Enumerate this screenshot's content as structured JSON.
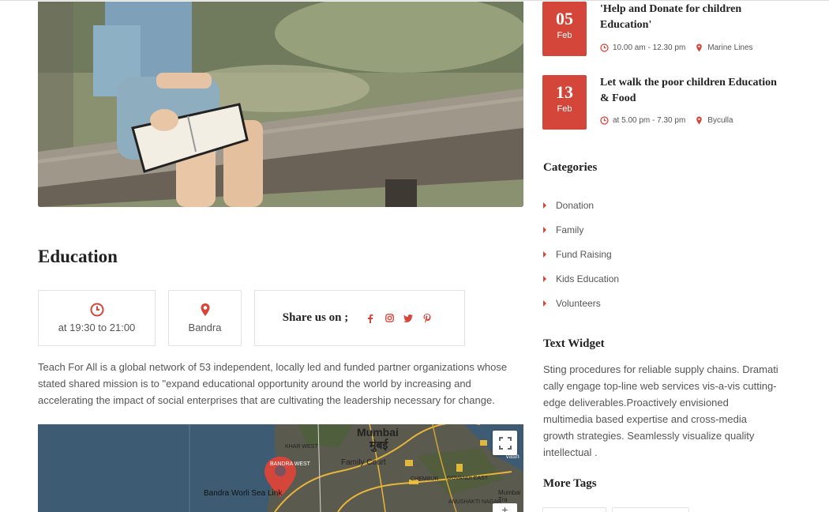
{
  "main": {
    "title": "Education",
    "time": "at 19:30 to 21:00",
    "place": "Bandra",
    "share_label": "Share us on ;",
    "social": [
      {
        "icon": "facebook-icon",
        "glyph": "f"
      },
      {
        "icon": "instagram-icon",
        "glyph": "◎"
      },
      {
        "icon": "twitter-icon",
        "glyph": "🐦"
      },
      {
        "icon": "pinterest-icon",
        "glyph": "℗"
      }
    ],
    "description": "Teach For All is a global network of 53 independent, locally led and funded partner organizations whose stated shared mission is to \"expand educational opportunity around the world by increasing and accelerating the impact of social enterprises that are cultivating the leadership necessary for change.",
    "map": {
      "city": "Mumbai",
      "city_local": "मुंबई",
      "labels": [
        "KHAR WEST",
        "BANDRA WEST",
        "Family Court",
        "Bandra Worli Sea Link",
        "CHEMBUR",
        "GOVANDI EAST",
        "ANUSHAKTI NAGAR",
        "Mumbai Tra",
        "Vash"
      ],
      "zoom_label": "+"
    }
  },
  "sidebar": {
    "events": [
      {
        "day": "05",
        "month": "Feb",
        "title": "'Help and Donate for children Education'",
        "time": "10.00 am - 12.30 pm",
        "place": "Marine Lines"
      },
      {
        "day": "13",
        "month": "Feb",
        "title": "Let walk the poor children Education & Food",
        "time": "at 5.00 pm - 7.30 pm",
        "place": "Byculla"
      }
    ],
    "categories_title": "Categories",
    "categories": [
      "Donation",
      "Family",
      "Fund Raising",
      "Kids Education",
      "Volunteers"
    ],
    "text_widget_title": "Text Widget",
    "text_widget_body": "Sting procedures for reliable supply chains. Dramati cally engage top-line web services vis-a-vis cutting-edge deliverables.Proactively envisioned multimedia based expertise and cross-media growth strategies. Seamlessly visualize quality intellectual .",
    "tags_title": "More Tags"
  },
  "colors": {
    "accent": "#d4463a",
    "heading": "#222222",
    "text": "#555555",
    "border": "#e3e3e3"
  }
}
